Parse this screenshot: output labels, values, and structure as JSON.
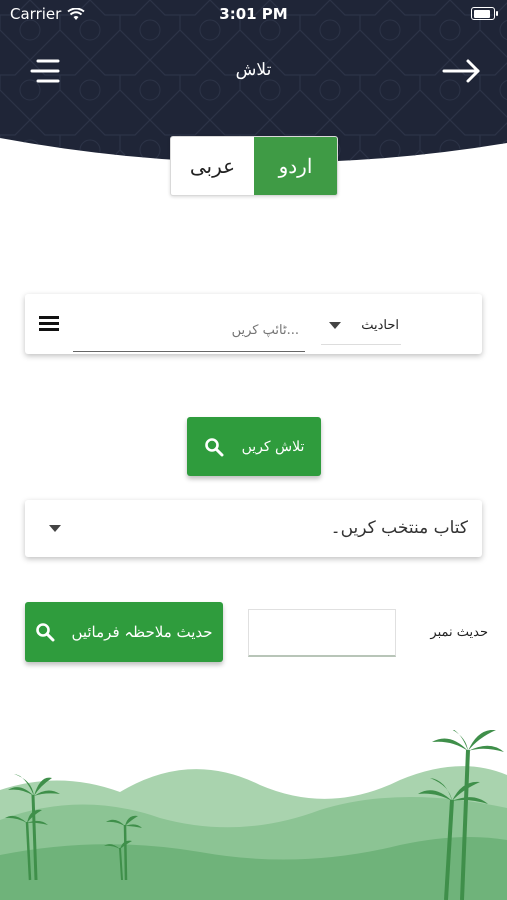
{
  "status_bar": {
    "carrier": "Carrier",
    "time": "3:01 PM"
  },
  "header": {
    "title": "تلاش",
    "menu_icon": "menu-icon",
    "back_icon": "arrow-right-icon",
    "background": "#1f2537"
  },
  "language_toggle": {
    "options": [
      "عربی",
      "اردو"
    ],
    "selected": "اردو",
    "accent": "#3f9b45"
  },
  "search": {
    "placeholder": "ٹائپ کریں...",
    "value": "",
    "category": "احادیث"
  },
  "search_button": {
    "label": "تلاش کریں",
    "icon": "search-icon",
    "color": "#2f9c3d"
  },
  "book_select": {
    "value": "کتاب منتخب کریں۔"
  },
  "hadith_number": {
    "label": "حدیث نمبر",
    "value": ""
  },
  "view_button": {
    "label": "حدیث ملاحظہ فرمائیں",
    "icon": "search-icon"
  }
}
